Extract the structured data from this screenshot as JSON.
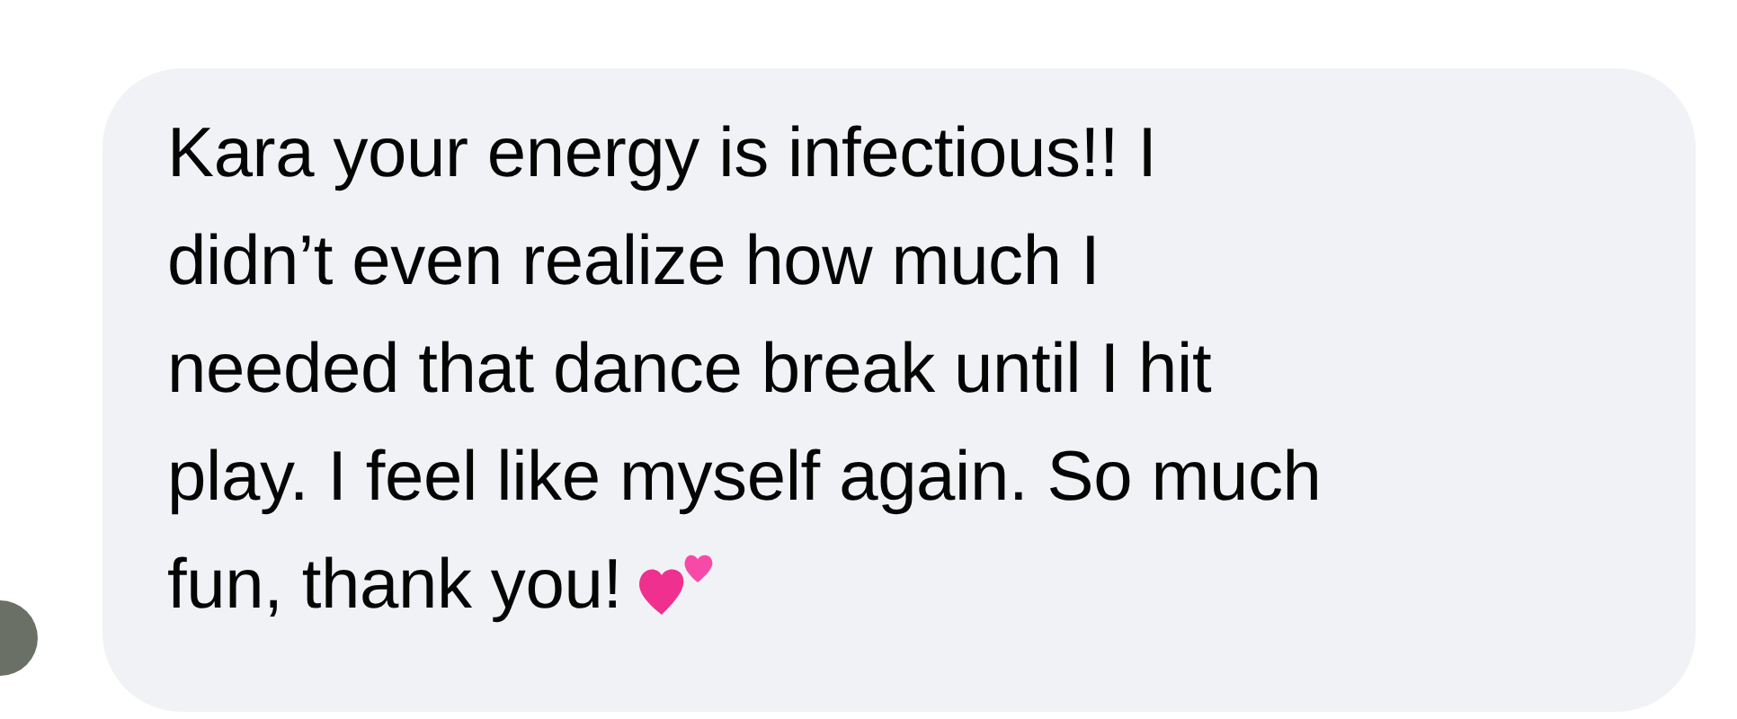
{
  "message": {
    "text": "Kara your energy is infectious!! I\ndidn’t even realize how much I\nneeded that dance break until I hit\nplay. I feel like myself again. So much\nfun, thank you!"
  }
}
